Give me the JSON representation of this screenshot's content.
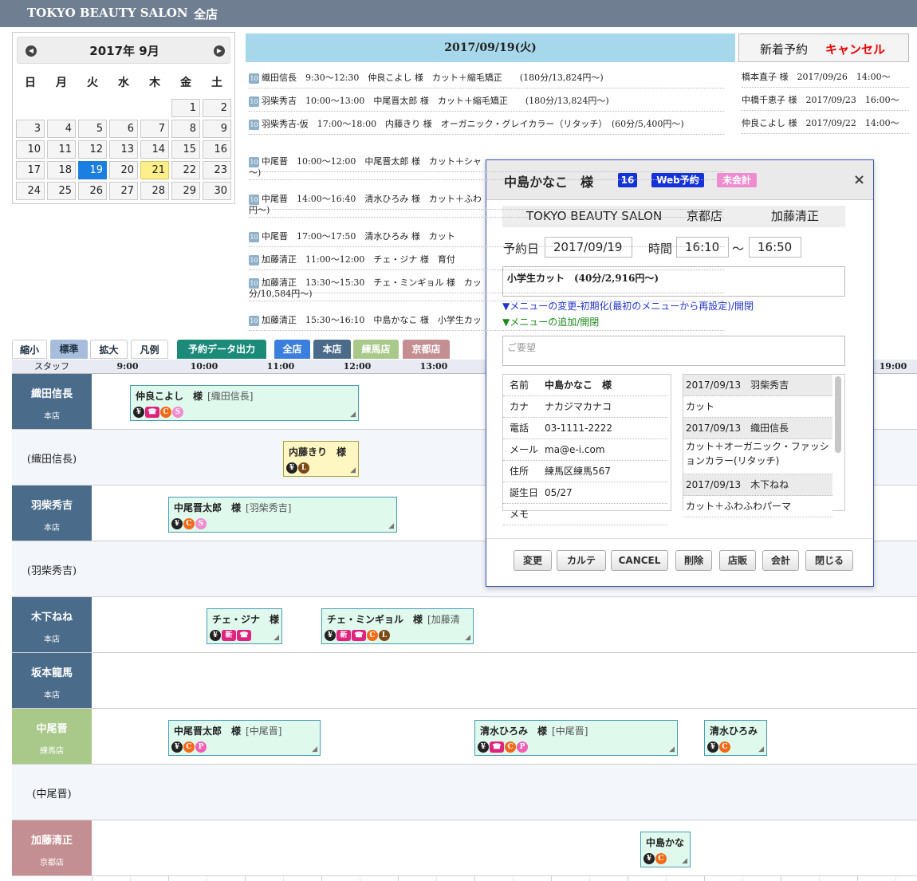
{
  "header": {
    "salon": "TOKYO BEAUTY SALON",
    "scope": "全店"
  },
  "calendar": {
    "title": "2017年 9月",
    "prev": "◀",
    "next": "▶",
    "dow": [
      "日",
      "月",
      "火",
      "水",
      "木",
      "金",
      "土"
    ],
    "weeks": [
      [
        "",
        "",
        "",
        "",
        "",
        "1",
        "2"
      ],
      [
        "3",
        "4",
        "5",
        "6",
        "7",
        "8",
        "9"
      ],
      [
        "10",
        "11",
        "12",
        "13",
        "14",
        "15",
        "16"
      ],
      [
        "17",
        "18",
        "19",
        "20",
        "21",
        "22",
        "23"
      ],
      [
        "24",
        "25",
        "26",
        "27",
        "28",
        "29",
        "30"
      ]
    ]
  },
  "day_panel": {
    "date": "2017/09/19(火)",
    "badge": "10",
    "reservations": [
      "織田信長　9:30〜12:30　仲良こよし 様　カット＋縮毛矯正　　(180分/13,824円〜)",
      "羽柴秀吉　10:00〜13:00　中尾晋太郎 様　カット＋縮毛矯正　　(180分/13,824円〜)",
      "羽柴秀吉-仮　17:00〜18:00　内藤きり 様　オーガニック・グレイカラー（リタッチ）　(60分/5,400円〜)",
      "中尾晋　10:00〜12:00　中尾晋太郎 様　カット＋シャ",
      "〜)",
      "中尾晋　14:00〜16:40　清水ひろみ 様　カット＋ふわ",
      "円〜)",
      "中尾晋　17:00〜17:50　清水ひろみ 様　カット",
      "加藤清正　11:00〜12:00　チェ・ジナ 様　育付",
      "加藤清正　13:30〜15:30　チェ・ミンギョル 様　カッ",
      "分/10,584円〜)",
      "加藤清正　15:30〜16:10　中島かなこ 様　小学生カッ"
    ]
  },
  "new_bookings": {
    "tab_new": "新着予約",
    "tab_cancel": "キャンセル",
    "items": [
      "橋本直子 様　2017/09/26　14:00〜",
      "中橋千恵子 様　2017/09/23　16:00〜",
      "仲良こよし 様　2017/09/22　14:00〜"
    ]
  },
  "toolbar": {
    "shrink": "縮小",
    "standard": "標準",
    "expand": "拡大",
    "legend": "凡例",
    "export": "予約データ出力",
    "all": "全店",
    "honten": "本店",
    "nerima": "練馬店",
    "kyoto": "京都店"
  },
  "timeline": {
    "staff_header": "スタッフ",
    "hours": [
      "9:00",
      "10:00",
      "11:00",
      "12:00",
      "13:00",
      "19:00"
    ],
    "rows": [
      {
        "name": "織田信長",
        "store": "本店"
      },
      {
        "name": "(織田信長)",
        "store": ""
      },
      {
        "name": "羽柴秀吉",
        "store": "本店"
      },
      {
        "name": "(羽柴秀吉)",
        "store": ""
      },
      {
        "name": "木下ねね",
        "store": "本店"
      },
      {
        "name": "坂本龍馬",
        "store": "本店"
      },
      {
        "name": "中尾晋",
        "store": "練馬店"
      },
      {
        "name": "(中尾晋)",
        "store": ""
      },
      {
        "name": "加藤清正",
        "store": "京都店"
      }
    ],
    "blocks": [
      {
        "name": "仲良こよし　様",
        "staff": "[織田信長]"
      },
      {
        "name": "内藤きり　様",
        "staff": ""
      },
      {
        "name": "中尾晋太郎　様",
        "staff": "[羽柴秀吉]"
      },
      {
        "name": "チェ・ジナ　様",
        "staff": ""
      },
      {
        "name": "チェ・ミンギョル　様",
        "staff": "[加藤清"
      },
      {
        "name": "中尾晋太郎　様",
        "staff": "[中尾晋]"
      },
      {
        "name": "清水ひろみ　様",
        "staff": "[中尾晋]"
      },
      {
        "name": "清水ひろみ",
        "staff": ""
      },
      {
        "name": "中島かな",
        "staff": ""
      }
    ],
    "icon_glyphs": {
      "yen": "¥",
      "phone": "☎",
      "new": "新",
      "c": "C",
      "s": "S",
      "p": "P",
      "l": "L"
    },
    "colors": {
      "store_honten": "#4a6b8a",
      "store_nerima": "#a9c98a",
      "store_kyoto": "#c48f92",
      "block_bg": "#dff9ed",
      "block_tentative": "#fff7c2"
    }
  },
  "modal": {
    "customer": "中島かなこ　様",
    "visit_count": "16",
    "web_tag": "Web予約",
    "unpaid_tag": "未会計",
    "close_glyph": "×",
    "salon": "TOKYO BEAUTY SALON",
    "store": "京都店",
    "stylist": "加藤清正",
    "date_label": "予約日",
    "date": "2017/09/19",
    "time_label": "時間",
    "start": "16:10",
    "tilde": "〜",
    "end": "16:50",
    "menu": "小学生カット　(40分/2,916円〜)",
    "menu_change": "▼メニューの変更-初期化(最初のメニューから再設定)/開閉",
    "menu_add": "▼メニューの追加/開閉",
    "request_placeholder": "ご要望",
    "info": [
      {
        "k": "名前",
        "v": "中島かなこ　様"
      },
      {
        "k": "カナ",
        "v": "ナカジマカナコ"
      },
      {
        "k": "電話",
        "v": "03-1111-2222"
      },
      {
        "k": "メール",
        "v": "ma@e-i.com"
      },
      {
        "k": "住所",
        "v": "練馬区練馬567"
      },
      {
        "k": "誕生日",
        "v": "05/27"
      },
      {
        "k": "メモ",
        "v": ""
      }
    ],
    "history": [
      {
        "text": "2017/09/13　羽柴秀吉",
        "head": true
      },
      {
        "text": "カット",
        "head": false
      },
      {
        "text": "2017/09/13　織田信長",
        "head": true
      },
      {
        "text": "カット＋オーガニック・ファッションカラー(リタッチ)",
        "head": false
      },
      {
        "text": "2017/09/13　木下ねね",
        "head": true
      },
      {
        "text": "カット＋ふわふわパーマ",
        "head": false
      }
    ],
    "buttons": [
      "変更",
      "カルテ",
      "CANCEL",
      "削除",
      "店販",
      "会計",
      "閉じる"
    ]
  }
}
